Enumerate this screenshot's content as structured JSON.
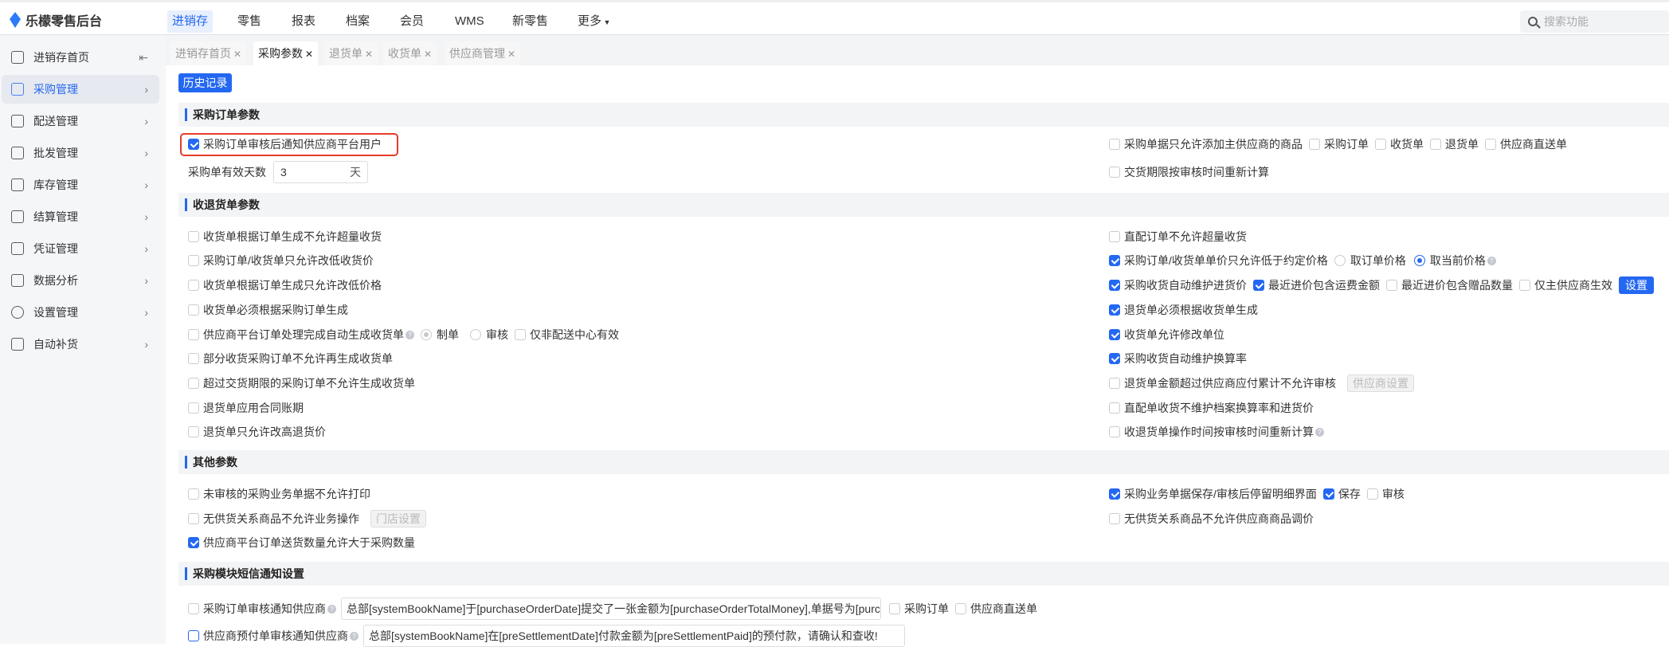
{
  "app": {
    "title": "乐檬零售后台"
  },
  "nav": [
    "进销存",
    "零售",
    "报表",
    "档案",
    "会员",
    "WMS",
    "新零售",
    "更多"
  ],
  "search": {
    "placeholder": "搜索功能"
  },
  "sidebar": [
    "进销存首页",
    "采购管理",
    "配送管理",
    "批发管理",
    "库存管理",
    "结算管理",
    "凭证管理",
    "数据分析",
    "设置管理",
    "自动补货"
  ],
  "tabs": [
    "进销存首页",
    "采购参数",
    "退货单",
    "收货单",
    "供应商管理"
  ],
  "history_button": "历史记录",
  "sections": [
    "采购订单参数",
    "收退货单参数",
    "其他参数",
    "采购模块短信通知设置"
  ],
  "s1": {
    "notify": "采购订单审核后通知供应商平台用户",
    "valid_days_label": "采购单有效天数",
    "valid_days": "3",
    "valid_days_unit": "天",
    "main_supplier_only": "采购单据只允许添加主供应商的商品",
    "opts": [
      "采购订单",
      "收货单",
      "退货单",
      "供应商直送单"
    ],
    "recalc_delivery": "交货期限按审核时间重新计算"
  },
  "s2": {
    "left": [
      "收货单根据订单生成不允许超量收货",
      "采购订单/收货单只允许改低收货价",
      "收货单根据订单生成只允许改低价格",
      "收货单必须根据采购订单生成",
      "供应商平台订单处理完成自动生成收货单",
      "部分收货采购订单不允许再生成收货单",
      "超过交货期限的采购订单不允许生成收货单",
      "退货单应用合同账期",
      "退货单只允许改高退货价"
    ],
    "auto_gen_opts": [
      "制单",
      "审核",
      "仅非配送中心有效"
    ],
    "right": [
      "直配订单不允许超量收货",
      "采购订单/收货单单价只允许低于约定价格",
      "采购收货自动维护进货价",
      "退货单必须根据收货单生成",
      "收货单允许修改单位",
      "采购收货自动维护换算率",
      "退货单金额超过供应商应付累计不允许审核",
      "直配单收货不维护档案换算率和进货价",
      "收退货单操作时间按审核时间重新计算"
    ],
    "price_opts": [
      "取订单价格",
      "取当前价格"
    ],
    "maintain_opts": [
      "最近进价包含运费金额",
      "最近进价包含赠品数量",
      "仅主供应商生效"
    ],
    "set_button": "设置",
    "supplier_settings": "供应商设置"
  },
  "s3": {
    "unaudited_print": "未审核的采购业务单据不允许打印",
    "no_supply": "无供货关系商品不允许业务操作",
    "store_settings": "门店设置",
    "over_qty": "供应商平台订单送货数量允许大于采购数量",
    "stay_detail": "采购业务单据保存/审核后停留明细界面",
    "stay_opts": [
      "保存",
      "审核"
    ],
    "no_supply_price": "无供货关系商品不允许供应商商品调价"
  },
  "s4": {
    "order_notify": "采购订单审核通知供应商",
    "order_template": "总部[systemBookName]于[purchaseOrderDate]提交了一张金额为[purchaseOrderTotalMoney],单据号为[purchaseOrderNum]",
    "order_opts": [
      "采购订单",
      "供应商直送单"
    ],
    "prepay_notify": "供应商预付单审核通知供应商",
    "prepay_template": "总部[systemBookName]在[preSettlementDate]付款金额为[preSettlementPaid]的预付款，请确认和查收!"
  }
}
